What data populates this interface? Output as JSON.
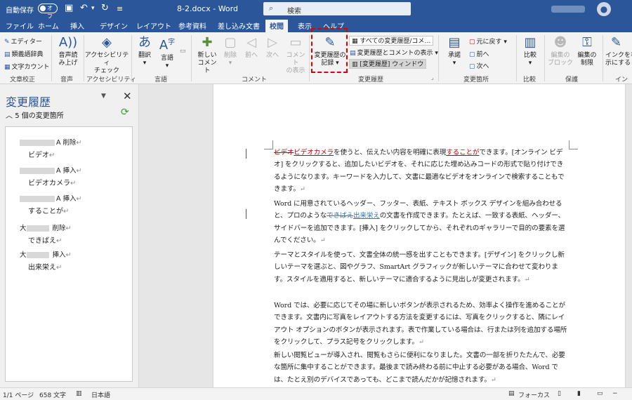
{
  "titlebar": {
    "autosave_label": "自動保存",
    "autosave_state": "オフ",
    "document_title": "8-2.docx - Word",
    "search_placeholder": "検索"
  },
  "tabs": [
    "ファイル",
    "ホーム",
    "挿入",
    "デザイン",
    "レイアウト",
    "参考資料",
    "差し込み文書",
    "校閲",
    "表示",
    "ヘルプ"
  ],
  "active_tab": "校閲",
  "ribbon": {
    "proofing": {
      "label": "文章校正",
      "editor": "エディター",
      "thesaurus": "類義語辞典",
      "word_count": "文字カウント"
    },
    "speech": {
      "label": "音声",
      "read_aloud_1": "音声読",
      "read_aloud_2": "み上げ"
    },
    "accessibility": {
      "label": "アクセシビリティ",
      "check_1": "アクセシビリティ",
      "check_2": "チェック"
    },
    "language": {
      "label": "言語",
      "translate": "翻訳",
      "language": "言語"
    },
    "comments": {
      "label": "コメント",
      "new_1": "新しい",
      "new_2": "コメント",
      "delete": "削除",
      "prev": "前へ",
      "next": "次へ",
      "show_1": "コメント",
      "show_2": "の表示"
    },
    "tracking": {
      "label": "変更履歴",
      "track_1": "変更履歴の",
      "track_2": "記録",
      "markup_option": "すべての変更履歴/コメ…",
      "show_markup": "変更履歴とコメントの表示",
      "reviewing_pane": "[変更履歴] ウィンドウ"
    },
    "changes": {
      "label": "変更箇所",
      "accept": "承諾",
      "reject": "元に戻す",
      "prev": "前へ",
      "next": "次へ"
    },
    "compare": {
      "label": "比較",
      "compare": "比較"
    },
    "protect": {
      "label": "保護",
      "block_1": "編集の",
      "block_2": "ブロック",
      "restrict_1": "編集の",
      "restrict_2": "制限"
    },
    "ink": {
      "label": "インク",
      "hide_1": "インクを非",
      "hide_2": "示にする"
    }
  },
  "navpane": {
    "title": "変更履歴",
    "count": "5 個の変更箇所",
    "changes": [
      {
        "author": "A",
        "action": "削除",
        "text": "ビデオ"
      },
      {
        "author": "A",
        "action": "挿入",
        "text": "ビデオカメラ"
      },
      {
        "author": "A",
        "action": "挿入",
        "text": "することが"
      },
      {
        "author": "大",
        "action": "削除",
        "text": "できばえ"
      },
      {
        "author": "大",
        "action": "挿入",
        "text": "出来栄え"
      }
    ]
  },
  "document": {
    "p1": {
      "del": "ビデオ",
      "ins": "ビデオカメラ",
      "t1": "を使うと、伝えたい内容を明確に表現",
      "ins2": "することが",
      "t2": "できます。[オンライン ビデオ] をクリックすると、追加したいビデオを、それに応じた埋め込みコードの形式で貼り付けできるようになります。キーワードを入力して、文書に最適なビデオをオンラインで検索することもできます。"
    },
    "p2": {
      "t1": "Word に用意されているヘッダー、フッター、表紙、テキスト ボックス デザインを組み合わせると、プロのような",
      "del": "できばえ",
      "ins": "出来栄え",
      "t2": "の文書を作成できます。たとえば、一致する表紙、ヘッダー、サイドバーを追加できます。[挿入] をクリックしてから、それぞれのギャラリーで目的の要素を選んでください。"
    },
    "p3": "テーマとスタイルを使って、文書全体の統一感を出すこともできます。[デザイン] をクリックし新しいテーマを選ぶと、図やグラフ、SmartArt グラフィックが新しいテーマに合わせて変わります。スタイルを適用すると、新しいテーマに適合するように見出しが変更されます。",
    "p4": "Word では、必要に応じてその場に新しいボタンが表示されるため、効率よく操作を進めることができます。文書内に写真をレイアウトする方法を変更するには、写真をクリックすると、隣にレイアウト オプションのボタンが表示されます。表で作業している場合は、行または列を追加する場所をクリックして、プラス記号をクリックします。",
    "p5": "新しい閲覧ビューが導入され、閲覧もさらに便利になりました。文書の一部を折りたたんで、必要な箇所に集中することができます。最後まで読み終わる前に中止する必要がある場合、Word では、たとえ別のデバイスであっても、どこまで読んだかが記憶されます。"
  },
  "statusbar": {
    "page": "1/1 ページ",
    "words": "658 文字",
    "language": "日本語",
    "focus": "フォーカス"
  }
}
